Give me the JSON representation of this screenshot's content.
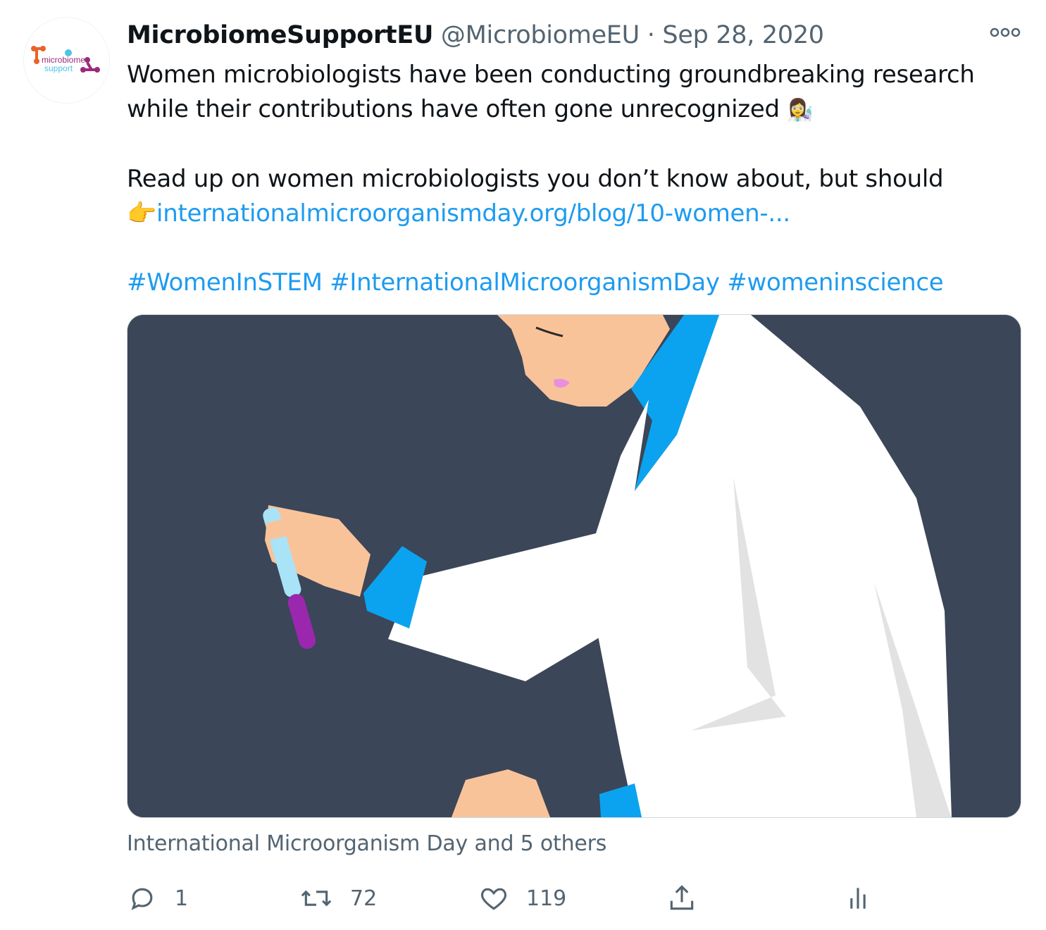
{
  "tweet": {
    "display_name": "MicrobiomeSupportEU",
    "handle": "@MicrobiomeEU",
    "separator": "·",
    "date": "Sep 28, 2020",
    "text_line1": "Women microbiologists have been conducting groundbreaking research",
    "text_line2": "while their contributions have often gone unrecognized",
    "emoji_scientist": "👩‍🔬",
    "text_line3": "Read up on women microbiologists you don’t know about, but should",
    "emoji_point": "👉",
    "link_text": "internationalmicroorganismday.org/blog/10-women-...",
    "hashtags": [
      "#WomenInSTEM",
      "#InternationalMicroorganismDay",
      "#womeninscience"
    ],
    "tagged_users": "International Microorganism Day and 5 others"
  },
  "avatar": {
    "logo_text_top": "microbiome",
    "logo_text_bottom": "support",
    "colors": {
      "orange": "#e8632a",
      "purple": "#9b2a7a",
      "cyan": "#4fc3e8"
    }
  },
  "actions": {
    "reply_count": "1",
    "retweet_count": "72",
    "like_count": "119",
    "icons": [
      "reply-icon",
      "retweet-icon",
      "like-icon",
      "share-icon",
      "analytics-icon"
    ]
  },
  "colors": {
    "link": "#1d9bf0",
    "secondary_text": "#536471",
    "image_bg": "#3b4658",
    "coat": "#ffffff",
    "shirt": "#0ba3ef",
    "skin": "#f9c39a",
    "tube_liquid": "#9b27af",
    "tube_glass": "#a8e3f8"
  }
}
